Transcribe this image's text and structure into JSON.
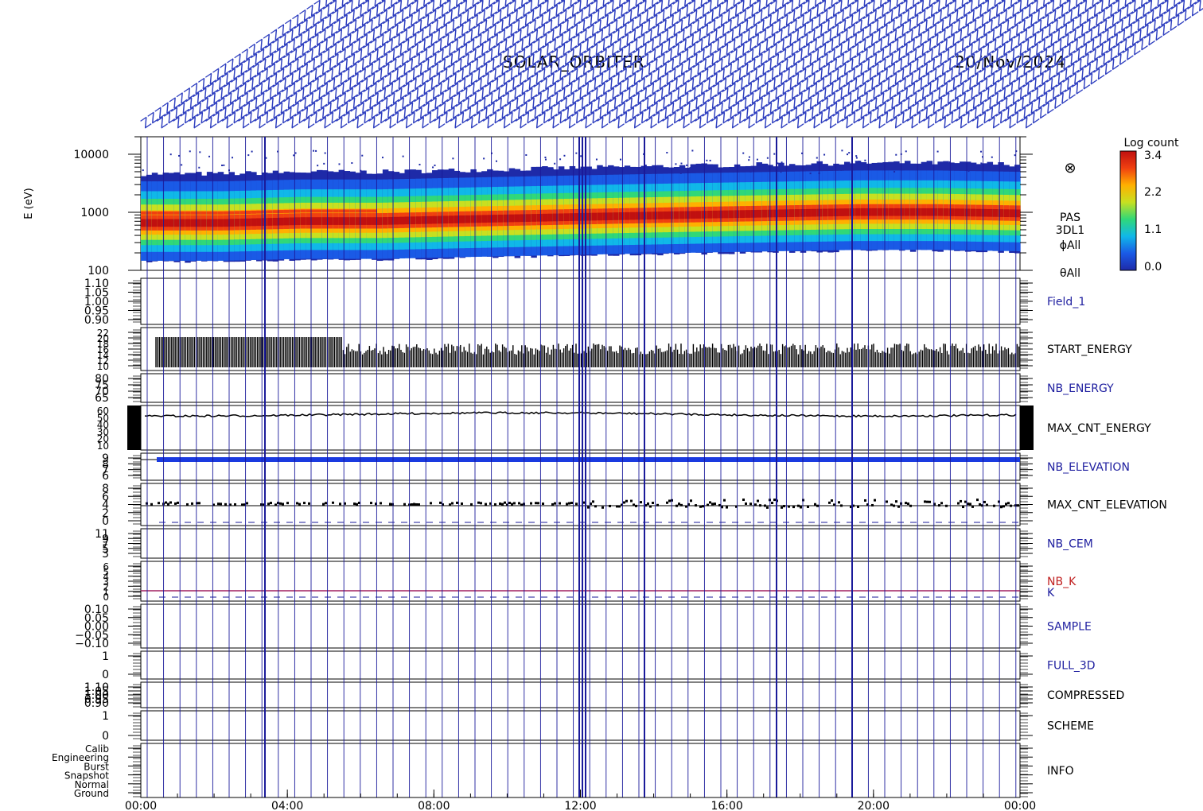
{
  "header": {
    "title": "SOLAR_ORBITER",
    "date": "20/Nov/2024"
  },
  "colorbar": {
    "title": "Log count",
    "ticks": [
      "3.4",
      "2.2",
      "1.1",
      "0.0"
    ]
  },
  "spectrogram": {
    "ylabel": "E (eV)",
    "yticks": [
      "10000",
      "1000",
      "100"
    ],
    "labels": [
      "PAS",
      "3DL1",
      "ϕAll",
      "θAll"
    ],
    "marker": "⊗",
    "band_center_ev": [
      650,
      650,
      700,
      700,
      750,
      800,
      850,
      900,
      950,
      1000,
      1000,
      950
    ]
  },
  "xaxis": {
    "ticks": [
      "00:00",
      "04:00",
      "08:00",
      "12:00",
      "16:00",
      "20:00",
      "00:00"
    ]
  },
  "panels": [
    {
      "id": "field_1",
      "label": "Field_1",
      "label_color": "#2020a0",
      "ticks": [
        "1.10",
        "1.05",
        "1.00",
        "0.95",
        "0.90"
      ]
    },
    {
      "id": "start_energy",
      "label": "START_ENERGY",
      "label_color": "#000000",
      "ticks": [
        "22",
        "20",
        "18",
        "16",
        "14",
        "12",
        "10"
      ]
    },
    {
      "id": "nb_energy",
      "label": "NB_ENERGY",
      "label_color": "#2020a0",
      "ticks": [
        "80",
        "75",
        "70",
        "65"
      ]
    },
    {
      "id": "max_cnt_energy",
      "label": "MAX_CNT_ENERGY",
      "label_color": "#000000",
      "ticks": [
        "60",
        "50",
        "40",
        "30",
        "20",
        "10"
      ]
    },
    {
      "id": "nb_elevation",
      "label": "NB_ELEVATION",
      "label_color": "#2020a0",
      "ticks": [
        "9",
        "8",
        "7",
        "6"
      ]
    },
    {
      "id": "max_cnt_elevation",
      "label": "MAX_CNT_ELEVATION",
      "label_color": "#000000",
      "ticks": [
        "8",
        "6",
        "4",
        "2",
        "0"
      ]
    },
    {
      "id": "nb_cem",
      "label": "NB_CEM",
      "label_color": "#2020a0",
      "ticks": [
        "11",
        "9",
        "7",
        "5",
        "3"
      ]
    },
    {
      "id": "nb_k",
      "label": "NB_K",
      "label_color": "#c02020",
      "label2": "K",
      "label2_color": "#2020a0",
      "ticks": [
        "6",
        "5",
        "4",
        "3",
        "2",
        "1",
        "0"
      ]
    },
    {
      "id": "sample",
      "label": "SAMPLE",
      "label_color": "#2020a0",
      "ticks": [
        "0.10",
        "0.05",
        "0.00",
        "−0.05",
        "−0.10"
      ]
    },
    {
      "id": "full_3d",
      "label": "FULL_3D",
      "label_color": "#2020a0",
      "ticks": [
        "1",
        "0"
      ]
    },
    {
      "id": "compressed",
      "label": "COMPRESSED",
      "label_color": "#000000",
      "ticks": [
        "1.10",
        "1.05",
        "1.00",
        "0.95",
        "0.90"
      ]
    },
    {
      "id": "scheme",
      "label": "SCHEME",
      "label_color": "#000000",
      "ticks": [
        "1",
        "0"
      ]
    },
    {
      "id": "info",
      "label": "INFO",
      "label_color": "#000000",
      "ticks": [
        "Calib",
        "Engineering",
        "Burst",
        "Snapshot",
        "Normal",
        "Ground"
      ]
    }
  ],
  "colors": {
    "event_line": "#1a1a9a",
    "axis": "#000000",
    "data_blue": "#1a3ae0",
    "k_line": "#a02060"
  }
}
